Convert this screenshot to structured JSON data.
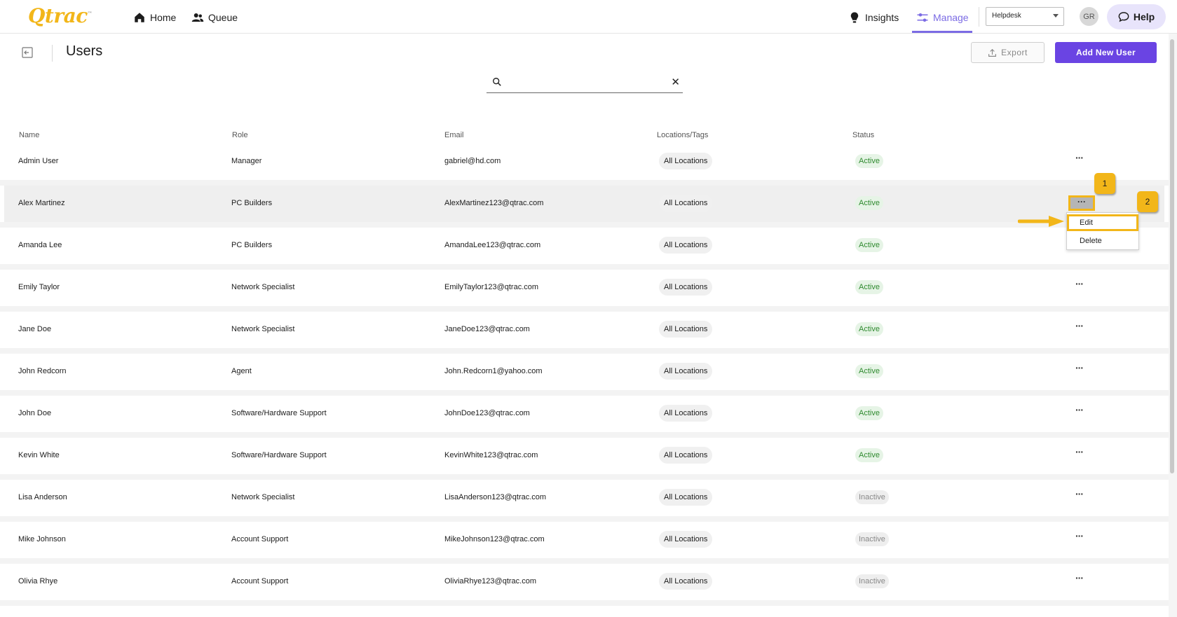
{
  "nav": {
    "logo": "Qtrac",
    "logo_mark": "™",
    "home": "Home",
    "queue": "Queue",
    "insights": "Insights",
    "manage": "Manage",
    "workspace": "Helpdesk",
    "avatar_initials": "GR",
    "help": "Help",
    "accent_color": "#7b6be4"
  },
  "page": {
    "title": "Users",
    "export_label": "Export",
    "add_label": "Add New User",
    "primary_color": "#6a44e3"
  },
  "search": {
    "value": "",
    "clear_icon": "close-icon"
  },
  "table": {
    "headers": [
      "Name",
      "Role",
      "Email",
      "Locations/Tags",
      "Status"
    ],
    "rows": [
      {
        "name": "Admin User",
        "role": "Manager",
        "email": "gabriel@hd.com",
        "location": "All Locations",
        "status": "Active"
      },
      {
        "name": "Alex Martinez",
        "role": "PC Builders",
        "email": "AlexMartinez123@qtrac.com",
        "location": "All Locations",
        "status": "Active"
      },
      {
        "name": "Amanda Lee",
        "role": "PC Builders",
        "email": "AmandaLee123@qtrac.com",
        "location": "All Locations",
        "status": "Active"
      },
      {
        "name": "Emily Taylor",
        "role": "Network Specialist",
        "email": "EmilyTaylor123@qtrac.com",
        "location": "All Locations",
        "status": "Active"
      },
      {
        "name": "Jane Doe",
        "role": "Network Specialist",
        "email": "JaneDoe123@qtrac.com",
        "location": "All Locations",
        "status": "Active"
      },
      {
        "name": "John Redcorn",
        "role": "Agent",
        "email": "John.Redcorn1@yahoo.com",
        "location": "All Locations",
        "status": "Active"
      },
      {
        "name": "John Doe",
        "role": "Software/Hardware Support",
        "email": "JohnDoe123@qtrac.com",
        "location": "All Locations",
        "status": "Active"
      },
      {
        "name": "Kevin White",
        "role": "Software/Hardware Support",
        "email": "KevinWhite123@qtrac.com",
        "location": "All Locations",
        "status": "Active"
      },
      {
        "name": "Lisa Anderson",
        "role": "Network Specialist",
        "email": "LisaAnderson123@qtrac.com",
        "location": "All Locations",
        "status": "Inactive"
      },
      {
        "name": "Mike Johnson",
        "role": "Account Support",
        "email": "MikeJohnson123@qtrac.com",
        "location": "All Locations",
        "status": "Inactive"
      },
      {
        "name": "Olivia Rhye",
        "role": "Account Support",
        "email": "OliviaRhye123@qtrac.com",
        "location": "All Locations",
        "status": "Inactive"
      }
    ],
    "more_label": "···"
  },
  "row_menu": {
    "edit": "Edit",
    "delete": "Delete"
  },
  "annotations": {
    "step1": "1",
    "step2": "2",
    "color": "#f2b619"
  }
}
